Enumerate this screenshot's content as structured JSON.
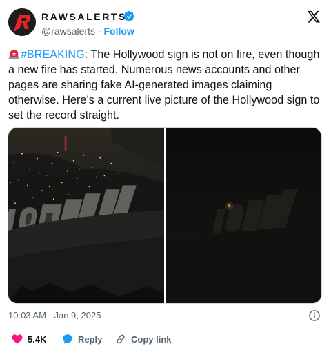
{
  "account": {
    "display_name": "RAWSALERTS",
    "handle": "@rawsalerts",
    "separator": "·",
    "follow_label": "Follow"
  },
  "tweet": {
    "hashtag": "#BREAKING",
    "body": ": The Hollywood sign is not on fire, even though a new fire has started. Numerous news accounts and other pages are sharing fake AI-generated images claiming otherwise. Here’s a current live picture of the Hollywood sign to set the record straight.",
    "timestamp": "10:03 AM · Jan 9, 2025"
  },
  "actions": {
    "like_count": "5.4K",
    "reply_label": "Reply",
    "copy_link_label": "Copy link"
  },
  "icons": [
    "rawsalerts-logo-icon",
    "verified-badge-icon",
    "x-logo-icon",
    "siren-emoji-icon",
    "info-icon",
    "heart-icon",
    "reply-bubble-icon",
    "link-icon"
  ],
  "colors": {
    "accent": "#1d9bf0",
    "like": "#f91880",
    "secondary_text": "#536471"
  }
}
